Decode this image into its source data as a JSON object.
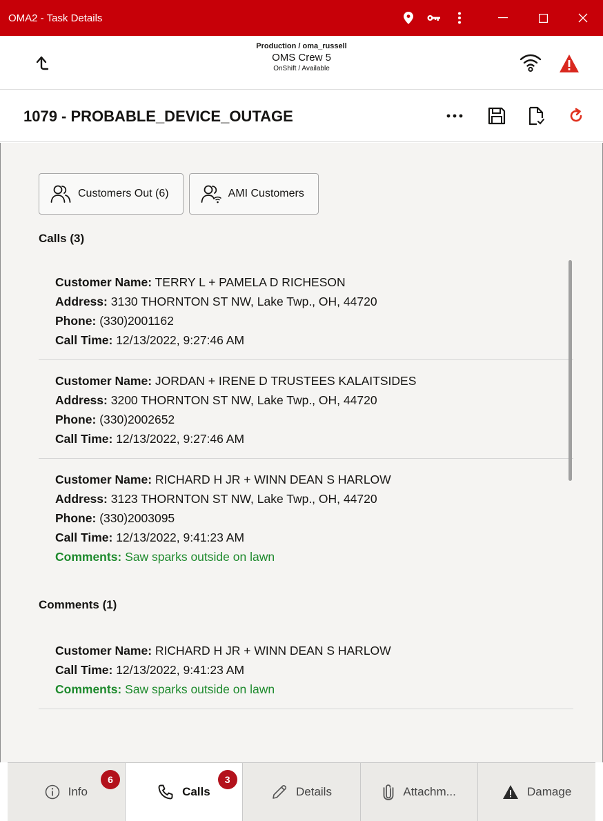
{
  "window": {
    "title": "OMA2 - Task Details",
    "icons": [
      "location-icon",
      "key-icon",
      "more-vertical-icon"
    ],
    "controls": [
      "minimize-icon",
      "maximize-icon",
      "close-icon"
    ]
  },
  "header": {
    "environment": "Production / oma_russell",
    "crew": "OMS Crew 5",
    "status": "OnShift / Available"
  },
  "task": {
    "title": "1079 - PROBABLE_DEVICE_OUTAGE",
    "actions": [
      "more-horizontal-icon",
      "save-icon",
      "document-check-icon",
      "refresh-icon"
    ]
  },
  "buttons": {
    "customers_out": "Customers Out (6)",
    "ami_customers": "AMI Customers"
  },
  "calls": {
    "heading": "Calls  (3)",
    "labels": {
      "name": "Customer Name:",
      "address": "Address:",
      "phone": "Phone:",
      "call_time": "Call Time:",
      "comments": "Comments:"
    },
    "items": [
      {
        "name": "TERRY L + PAMELA D RICHESON",
        "address": "3130 THORNTON ST NW, Lake Twp., OH, 44720",
        "phone": "(330)2001162",
        "call_time": "12/13/2022, 9:27:46 AM"
      },
      {
        "name": "JORDAN + IRENE D TRUSTEES KALAITSIDES",
        "address": "3200 THORNTON ST NW, Lake Twp., OH, 44720",
        "phone": "(330)2002652",
        "call_time": "12/13/2022, 9:27:46 AM"
      },
      {
        "name": "RICHARD H JR + WINN DEAN S HARLOW",
        "address": "3123 THORNTON ST NW, Lake Twp., OH, 44720",
        "phone": "(330)2003095",
        "call_time": "12/13/2022, 9:41:23 AM",
        "comment": "Saw sparks outside on lawn"
      }
    ]
  },
  "comments": {
    "heading": "Comments (1)",
    "items": [
      {
        "name": "RICHARD H JR + WINN DEAN S HARLOW",
        "call_time": "12/13/2022, 9:41:23 AM",
        "comment": "Saw sparks outside on lawn"
      }
    ]
  },
  "tabs": [
    {
      "label": "Info",
      "badge": "6",
      "icon": "info-icon"
    },
    {
      "label": "Calls",
      "badge": "3",
      "icon": "phone-icon",
      "active": true
    },
    {
      "label": "Details",
      "icon": "pencil-icon"
    },
    {
      "label": "Attachm...",
      "icon": "paperclip-icon"
    },
    {
      "label": "Damage",
      "icon": "warning-icon"
    }
  ],
  "colors": {
    "title_bar": "#c70008",
    "comment_text": "#1e8a2d",
    "badge": "#b3121c",
    "warning": "#d9281f",
    "refresh": "#e0311f"
  }
}
